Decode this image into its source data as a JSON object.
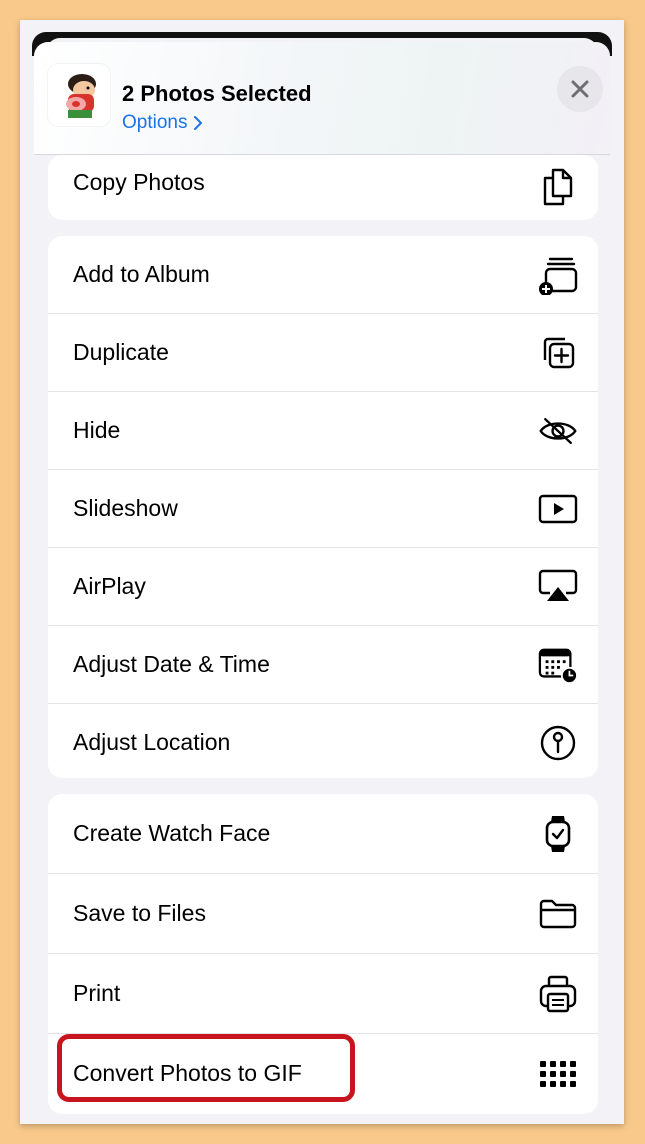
{
  "header": {
    "title": "2 Photos Selected",
    "options_label": "Options",
    "options_chevron": "chevron-right-icon",
    "close_icon": "close-icon",
    "thumbnail": "cartoon-character-thumbnail"
  },
  "accent_color": "#1a73e8",
  "highlight_color": "#c8141e",
  "groups": [
    {
      "items": [
        {
          "label": "Copy Photos",
          "icon": "copy-icon"
        }
      ]
    },
    {
      "items": [
        {
          "label": "Add to Album",
          "icon": "add-to-album-icon"
        },
        {
          "label": "Duplicate",
          "icon": "duplicate-icon"
        },
        {
          "label": "Hide",
          "icon": "eye-slash-icon"
        },
        {
          "label": "Slideshow",
          "icon": "play-rectangle-icon"
        },
        {
          "label": "AirPlay",
          "icon": "airplay-icon"
        },
        {
          "label": "Adjust Date & Time",
          "icon": "calendar-clock-icon"
        },
        {
          "label": "Adjust Location",
          "icon": "location-pin-icon"
        }
      ]
    },
    {
      "items": [
        {
          "label": "Create Watch Face",
          "icon": "watch-icon"
        },
        {
          "label": "Save to Files",
          "icon": "folder-icon"
        },
        {
          "label": "Print",
          "icon": "printer-icon"
        },
        {
          "label": "Convert Photos to GIF",
          "icon": "grid-dots-icon"
        }
      ]
    }
  ]
}
